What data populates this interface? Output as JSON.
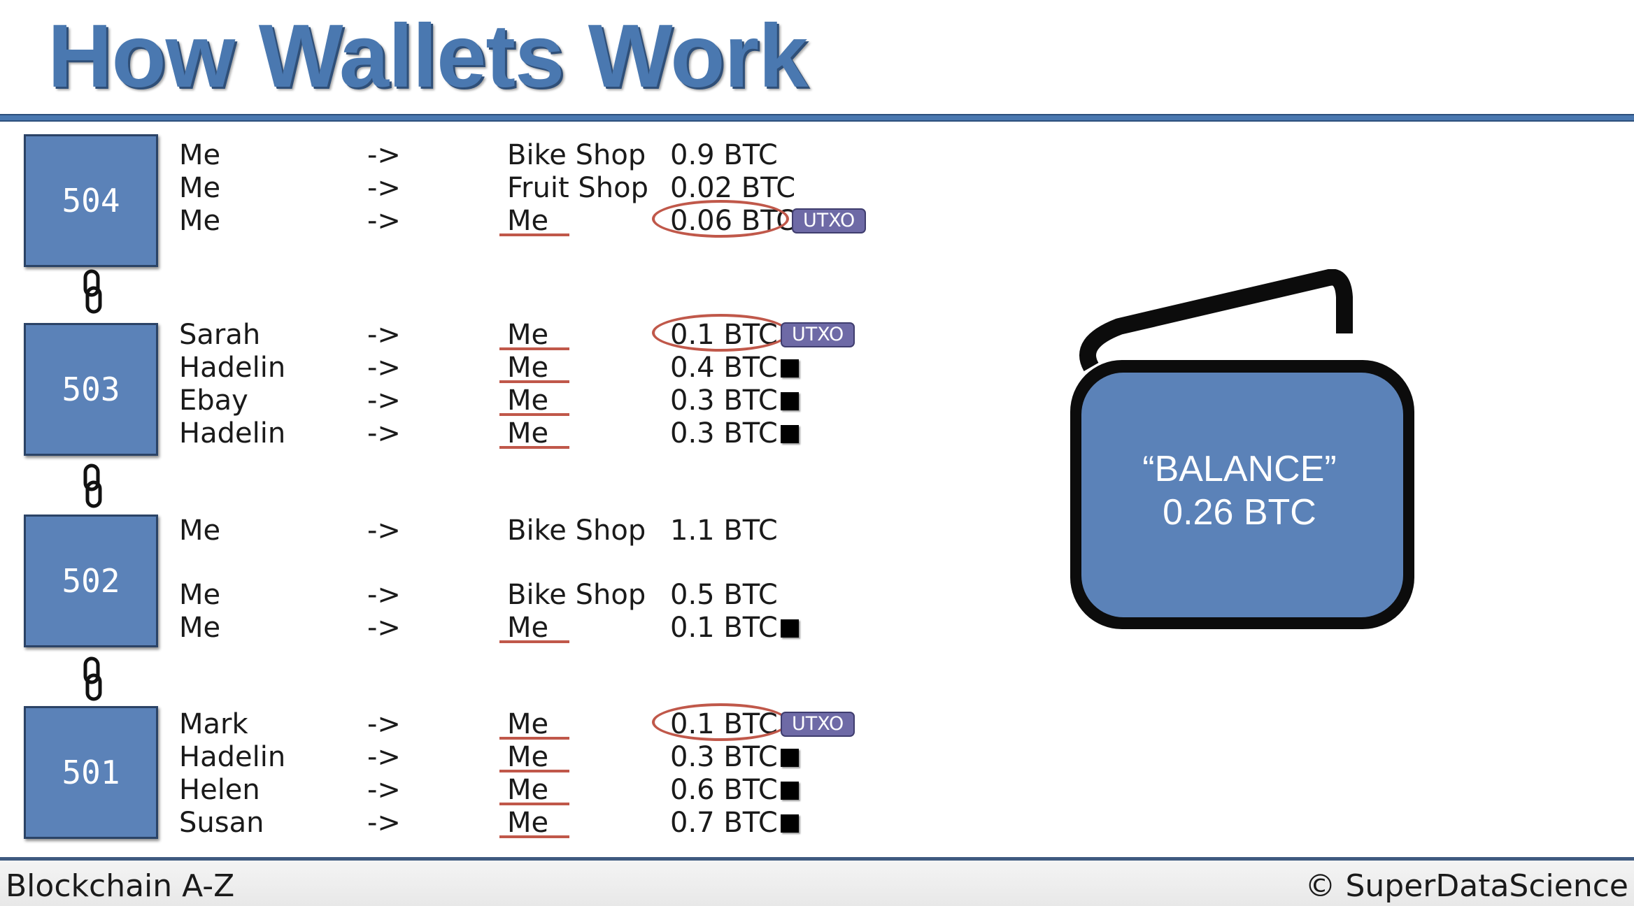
{
  "title": "How Wallets Work",
  "footer": {
    "left": "Blockchain A-Z",
    "right": "© SuperDataScience"
  },
  "arrow": "->",
  "utxo_label": "UTXO",
  "wallet": {
    "label": "“BALANCE”",
    "value": "0.26 BTC",
    "fill_color": "#5b82b8"
  },
  "colors": {
    "accent": "#4a78b0",
    "highlight": "#c0584a",
    "utxo_badge": "#6e6aa6"
  },
  "blocks": [
    {
      "id": "504",
      "rows": [
        {
          "from": "Me",
          "to": "Bike Shop",
          "amount": "0.9 BTC"
        },
        {
          "from": "Me",
          "to": "Fruit Shop",
          "amount": "0.02 BTC"
        },
        {
          "from": "Me",
          "to": "Me",
          "amount": "0.06 BTC",
          "utxo": true
        }
      ]
    },
    {
      "id": "503",
      "rows": [
        {
          "from": "Sarah",
          "to": "Me",
          "amount": "0.1 BTC",
          "utxo": true
        },
        {
          "from": "Hadelin",
          "to": "Me",
          "amount": "0.4 BTC",
          "spent": true
        },
        {
          "from": "Ebay",
          "to": "Me",
          "amount": "0.3 BTC",
          "spent": true
        },
        {
          "from": "Hadelin",
          "to": "Me",
          "amount": "0.3 BTC",
          "spent": true
        }
      ]
    },
    {
      "id": "502",
      "rows": [
        {
          "from": "Me",
          "to": "Bike Shop",
          "amount": "1.1 BTC"
        },
        {
          "from": "Me",
          "to": "Bike Shop",
          "amount": "0.5 BTC"
        },
        {
          "from": "Me",
          "to": "Me",
          "amount": "0.1 BTC",
          "spent": true
        }
      ]
    },
    {
      "id": "501",
      "rows": [
        {
          "from": "Mark",
          "to": "Me",
          "amount": "0.1 BTC",
          "utxo": true
        },
        {
          "from": "Hadelin",
          "to": "Me",
          "amount": "0.3 BTC",
          "spent": true
        },
        {
          "from": "Helen",
          "to": "Me",
          "amount": "0.6 BTC",
          "spent": true
        },
        {
          "from": "Susan",
          "to": "Me",
          "amount": "0.7 BTC",
          "spent": true
        }
      ]
    }
  ]
}
